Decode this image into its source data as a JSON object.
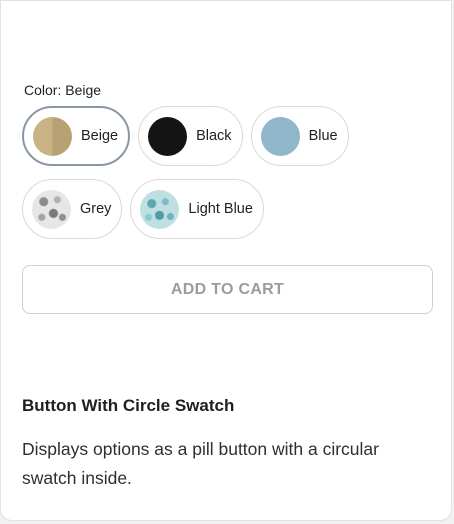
{
  "selector": {
    "label": "Color: Beige",
    "selected": "Beige",
    "options": [
      {
        "label": "Beige",
        "swatch": "beige-half-tone"
      },
      {
        "label": "Black",
        "swatch": "#141414"
      },
      {
        "label": "Blue",
        "swatch": "#8fb6cb"
      },
      {
        "label": "Grey",
        "swatch": "grey-pattern"
      },
      {
        "label": "Light Blue",
        "swatch": "light-blue-pattern"
      }
    ]
  },
  "cart": {
    "button_label": "ADD TO CART"
  },
  "info": {
    "title": "Button With Circle Swatch",
    "description": "Displays options as a pill button with a circular swatch inside."
  },
  "colors": {
    "selected_border": "#8a97a5",
    "pill_border": "#d8d8d8",
    "disabled_text": "#9c9c9c"
  }
}
